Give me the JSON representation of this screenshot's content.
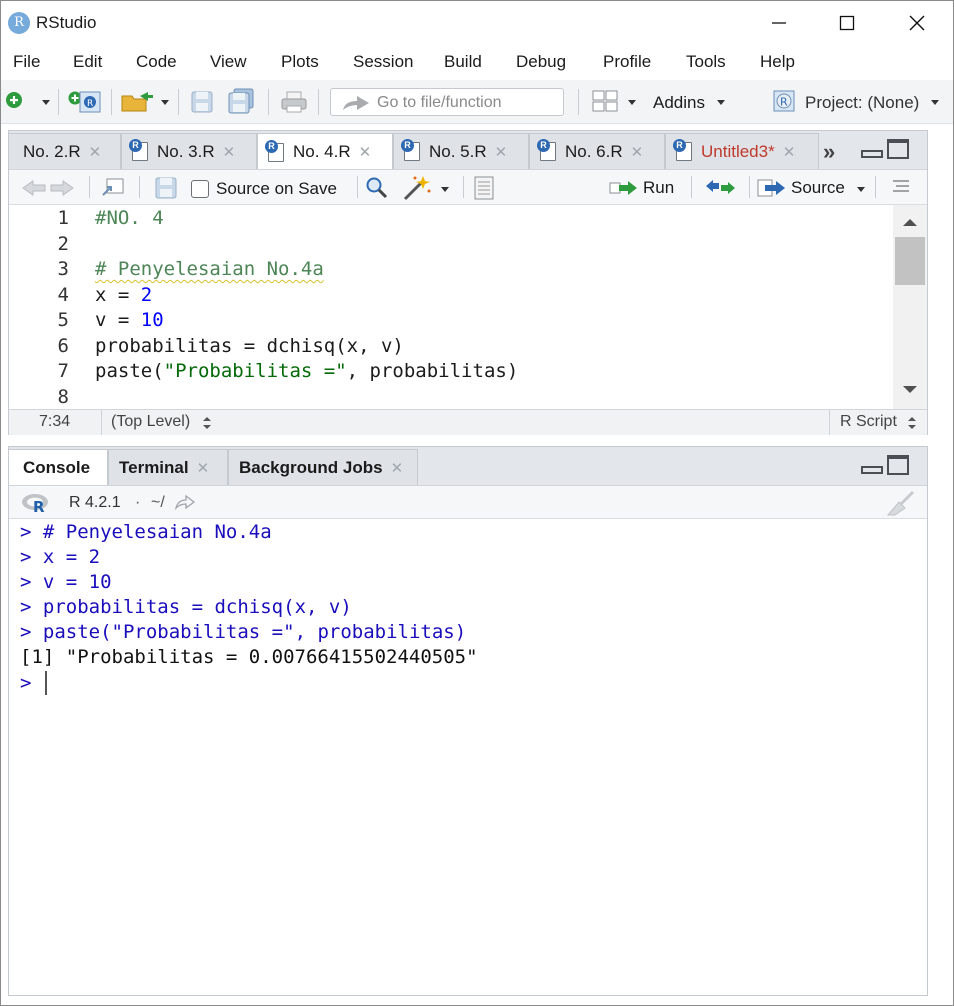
{
  "window": {
    "title": "RStudio",
    "logo_letter": "R"
  },
  "menu": [
    "File",
    "Edit",
    "Code",
    "View",
    "Plots",
    "Session",
    "Build",
    "Debug",
    "Profile",
    "Tools",
    "Help"
  ],
  "toolbar": {
    "goto_placeholder": "Go to file/function",
    "addins_label": "Addins",
    "project_label": "Project: (None)"
  },
  "editor": {
    "tabs": [
      {
        "label": "No. 2.R",
        "active": false,
        "unsaved": false
      },
      {
        "label": "No. 3.R",
        "active": false,
        "unsaved": false
      },
      {
        "label": "No. 4.R",
        "active": true,
        "unsaved": false
      },
      {
        "label": "No. 5.R",
        "active": false,
        "unsaved": false
      },
      {
        "label": "No. 6.R",
        "active": false,
        "unsaved": false
      },
      {
        "label": "Untitled3*",
        "active": false,
        "unsaved": true
      }
    ],
    "source_on_save_label": "Source on Save",
    "source_on_save_checked": false,
    "run_label": "Run",
    "source_label": "Source",
    "line_numbers": [
      "1",
      "2",
      "3",
      "4",
      "5",
      "6",
      "7",
      "8"
    ],
    "code_lines": [
      "#NO. 4",
      "",
      "# Penyelesaian No.4a",
      "x = 2",
      "v = 10",
      "probabilitas = dchisq(x, v)",
      "paste(\"Probabilitas =\", probabilitas)",
      ""
    ],
    "status": {
      "cursor_pos": "7:34",
      "scope": "(Top Level)",
      "file_type": "R Script"
    }
  },
  "console": {
    "tabs": [
      {
        "label": "Console",
        "active": true,
        "closable": false
      },
      {
        "label": "Terminal",
        "active": false,
        "closable": true
      },
      {
        "label": "Background Jobs",
        "active": false,
        "closable": true
      }
    ],
    "r_version": "R 4.2.1",
    "path": "~/",
    "prompt": ">",
    "lines": [
      {
        "prompt": ">",
        "text": "# Penyelesaian No.4a"
      },
      {
        "prompt": ">",
        "text": "x = 2"
      },
      {
        "prompt": ">",
        "text": "v = 10"
      },
      {
        "prompt": ">",
        "text": "probabilitas = dchisq(x, v)"
      },
      {
        "prompt": ">",
        "text": "paste(\"Probabilitas =\", probabilitas)"
      }
    ],
    "output": "[1] \"Probabilitas = 0.00766415502440505\""
  },
  "colors": {
    "comment": "#4d8556",
    "number": "#0000ff",
    "string": "#036a07",
    "console_input": "#1a0dbb",
    "unsaved_tab": "#c0392b",
    "r_blue": "#2d69b2"
  }
}
